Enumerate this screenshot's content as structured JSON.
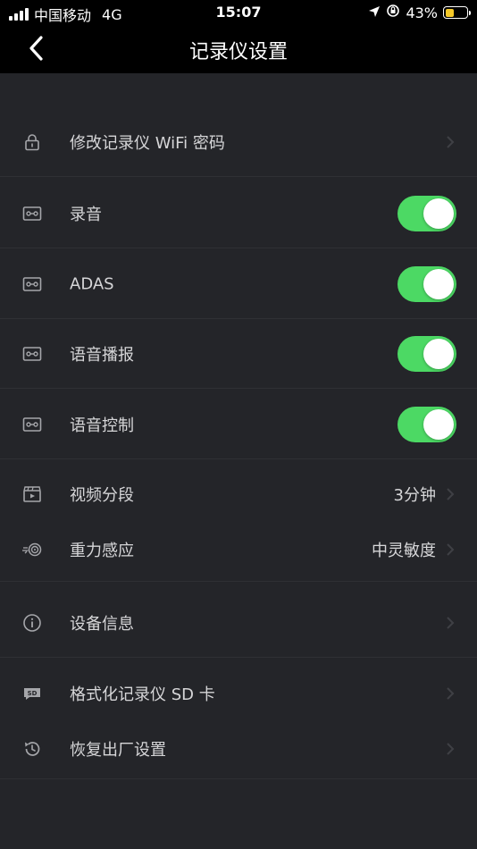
{
  "status_bar": {
    "carrier": "中国移动",
    "network": "4G",
    "time": "15:07",
    "battery_percent": "43%",
    "battery_level": 0.43,
    "battery_color": "#f6c928",
    "icons": [
      "signal-icon",
      "location-arrow-icon",
      "orientation-lock-icon",
      "battery-icon"
    ]
  },
  "nav": {
    "title": "记录仪设置",
    "back_icon": "chevron-left-icon"
  },
  "accent_color": "#4cd964",
  "settings": [
    {
      "label": "修改记录仪 WiFi 密码",
      "icon": "lock-icon",
      "type": "link"
    },
    {
      "label": "录音",
      "icon": "recorder-icon",
      "type": "toggle",
      "on": true
    },
    {
      "label": "ADAS",
      "icon": "recorder-icon",
      "type": "toggle",
      "on": true
    },
    {
      "label": "语音播报",
      "icon": "recorder-icon",
      "type": "toggle",
      "on": true
    },
    {
      "label": "语音控制",
      "icon": "recorder-icon",
      "type": "toggle",
      "on": true
    },
    {
      "label": "视频分段",
      "icon": "clapperboard-icon",
      "type": "link",
      "value": "3分钟"
    },
    {
      "label": "重力感应",
      "icon": "gravity-sensor-icon",
      "type": "link",
      "value": "中灵敏度"
    },
    {
      "label": "设备信息",
      "icon": "info-icon",
      "type": "link"
    },
    {
      "label": "格式化记录仪 SD 卡",
      "icon": "sd-card-icon",
      "type": "link"
    },
    {
      "label": "恢复出厂设置",
      "icon": "restore-icon",
      "type": "link"
    }
  ]
}
